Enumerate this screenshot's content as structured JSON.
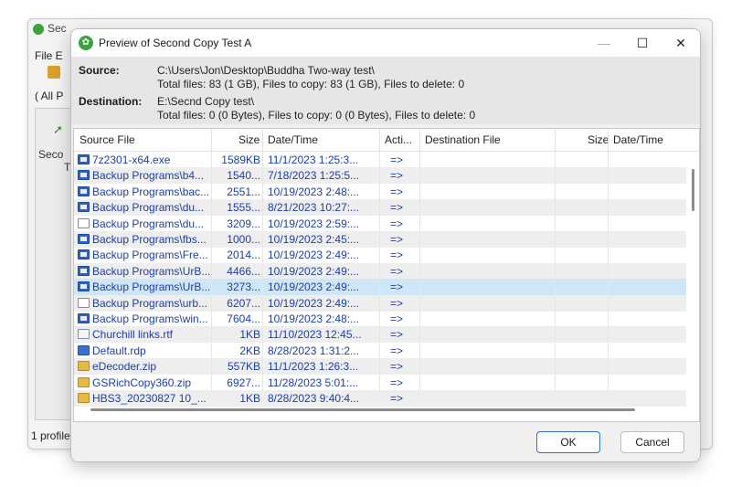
{
  "background_window": {
    "title_fragment": "Sec",
    "menu": "File  E",
    "tab_fragment": "(  All P",
    "panel_label_line1": "Seco",
    "panel_label_line2": "T",
    "status_text": "1 profile"
  },
  "dialog": {
    "title": "Preview of Second Copy Test A",
    "minimize_icon": "minimize-icon",
    "maximize_icon": "maximize-icon",
    "close_icon": "close-icon",
    "source_label": "Source:",
    "source_path": "C:\\Users\\Jon\\Desktop\\Buddha Two-way test\\",
    "source_totals": "Total files: 83 (1 GB), Files to copy: 83 (1 GB), Files to delete: 0",
    "destination_label": "Destination:",
    "destination_path": "E:\\Secnd Copy test\\",
    "destination_totals": "Total files: 0 (0 Bytes), Files to copy: 0 (0 Bytes), Files to delete: 0",
    "ok_label": "OK",
    "cancel_label": "Cancel"
  },
  "table": {
    "headers": {
      "source_file": "Source File",
      "size": "Size",
      "date_time": "Date/Time",
      "action": "Acti...",
      "destination_file": "Destination File",
      "dest_size": "Size",
      "dest_date_time": "Date/Time"
    },
    "rows": [
      {
        "icon": "exe",
        "name": "7z2301-x64.exe",
        "size": "1589KB",
        "date": "11/1/2023 1:25:3...",
        "action": "=>"
      },
      {
        "icon": "exe",
        "name": "Backup Programs\\b4...",
        "size": "1540...",
        "date": "7/18/2023 1:25:5...",
        "action": "=>"
      },
      {
        "icon": "exe",
        "name": "Backup Programs\\bac...",
        "size": "2551...",
        "date": "10/19/2023 2:48:...",
        "action": "=>"
      },
      {
        "icon": "exe",
        "name": "Backup Programs\\du...",
        "size": "1555...",
        "date": "8/21/2023 10:27:...",
        "action": "=>"
      },
      {
        "icon": "doc",
        "name": "Backup Programs\\du...",
        "size": "3209...",
        "date": "10/19/2023 2:59:...",
        "action": "=>"
      },
      {
        "icon": "exe",
        "name": "Backup Programs\\fbs...",
        "size": "1000...",
        "date": "10/19/2023 2:45:...",
        "action": "=>"
      },
      {
        "icon": "exe",
        "name": "Backup Programs\\Fre...",
        "size": "2014...",
        "date": "10/19/2023 2:49:...",
        "action": "=>"
      },
      {
        "icon": "exe",
        "name": "Backup Programs\\UrB...",
        "size": "4466...",
        "date": "10/19/2023 2:49:...",
        "action": "=>"
      },
      {
        "icon": "exe",
        "name": "Backup Programs\\UrB...",
        "size": "3273...",
        "date": "10/19/2023 2:49:...",
        "action": "=>"
      },
      {
        "icon": "doc",
        "name": "Backup Programs\\urb...",
        "size": "6207...",
        "date": "10/19/2023 2:49:...",
        "action": "=>"
      },
      {
        "icon": "exe",
        "name": "Backup Programs\\win...",
        "size": "7604...",
        "date": "10/19/2023 2:48:...",
        "action": "=>"
      },
      {
        "icon": "rtf",
        "name": "Churchill links.rtf",
        "size": "1KB",
        "date": "11/10/2023 12:45...",
        "action": "=>"
      },
      {
        "icon": "rdp",
        "name": "Default.rdp",
        "size": "2KB",
        "date": "8/28/2023 1:31:2...",
        "action": "=>"
      },
      {
        "icon": "zip",
        "name": "eDecoder.zip",
        "size": "557KB",
        "date": "11/1/2023 1:26:3...",
        "action": "=>"
      },
      {
        "icon": "zip",
        "name": "GSRichCopy360.zip",
        "size": "6927...",
        "date": "11/28/2023 5:01:...",
        "action": "=>"
      },
      {
        "icon": "zip",
        "name": "HBS3_20230827 10_...",
        "size": "1KB",
        "date": "8/28/2023 9:40:4...",
        "action": "=>"
      }
    ],
    "selected_row_index": 8
  }
}
